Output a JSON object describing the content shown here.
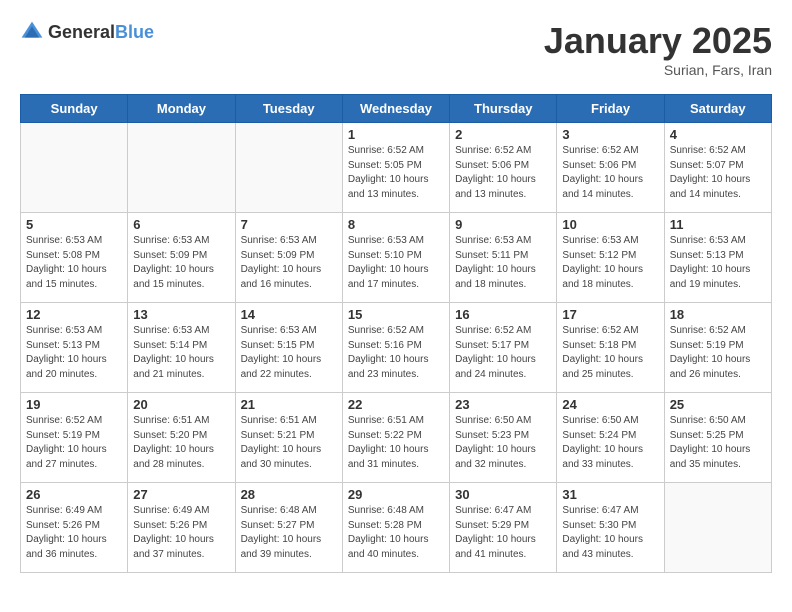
{
  "header": {
    "logo": {
      "general": "General",
      "blue": "Blue"
    },
    "title": "January 2025",
    "subtitle": "Surian, Fars, Iran"
  },
  "weekdays": [
    "Sunday",
    "Monday",
    "Tuesday",
    "Wednesday",
    "Thursday",
    "Friday",
    "Saturday"
  ],
  "weeks": [
    [
      {
        "day": "",
        "info": ""
      },
      {
        "day": "",
        "info": ""
      },
      {
        "day": "",
        "info": ""
      },
      {
        "day": "1",
        "info": "Sunrise: 6:52 AM\nSunset: 5:05 PM\nDaylight: 10 hours\nand 13 minutes."
      },
      {
        "day": "2",
        "info": "Sunrise: 6:52 AM\nSunset: 5:06 PM\nDaylight: 10 hours\nand 13 minutes."
      },
      {
        "day": "3",
        "info": "Sunrise: 6:52 AM\nSunset: 5:06 PM\nDaylight: 10 hours\nand 14 minutes."
      },
      {
        "day": "4",
        "info": "Sunrise: 6:52 AM\nSunset: 5:07 PM\nDaylight: 10 hours\nand 14 minutes."
      }
    ],
    [
      {
        "day": "5",
        "info": "Sunrise: 6:53 AM\nSunset: 5:08 PM\nDaylight: 10 hours\nand 15 minutes."
      },
      {
        "day": "6",
        "info": "Sunrise: 6:53 AM\nSunset: 5:09 PM\nDaylight: 10 hours\nand 15 minutes."
      },
      {
        "day": "7",
        "info": "Sunrise: 6:53 AM\nSunset: 5:09 PM\nDaylight: 10 hours\nand 16 minutes."
      },
      {
        "day": "8",
        "info": "Sunrise: 6:53 AM\nSunset: 5:10 PM\nDaylight: 10 hours\nand 17 minutes."
      },
      {
        "day": "9",
        "info": "Sunrise: 6:53 AM\nSunset: 5:11 PM\nDaylight: 10 hours\nand 18 minutes."
      },
      {
        "day": "10",
        "info": "Sunrise: 6:53 AM\nSunset: 5:12 PM\nDaylight: 10 hours\nand 18 minutes."
      },
      {
        "day": "11",
        "info": "Sunrise: 6:53 AM\nSunset: 5:13 PM\nDaylight: 10 hours\nand 19 minutes."
      }
    ],
    [
      {
        "day": "12",
        "info": "Sunrise: 6:53 AM\nSunset: 5:13 PM\nDaylight: 10 hours\nand 20 minutes."
      },
      {
        "day": "13",
        "info": "Sunrise: 6:53 AM\nSunset: 5:14 PM\nDaylight: 10 hours\nand 21 minutes."
      },
      {
        "day": "14",
        "info": "Sunrise: 6:53 AM\nSunset: 5:15 PM\nDaylight: 10 hours\nand 22 minutes."
      },
      {
        "day": "15",
        "info": "Sunrise: 6:52 AM\nSunset: 5:16 PM\nDaylight: 10 hours\nand 23 minutes."
      },
      {
        "day": "16",
        "info": "Sunrise: 6:52 AM\nSunset: 5:17 PM\nDaylight: 10 hours\nand 24 minutes."
      },
      {
        "day": "17",
        "info": "Sunrise: 6:52 AM\nSunset: 5:18 PM\nDaylight: 10 hours\nand 25 minutes."
      },
      {
        "day": "18",
        "info": "Sunrise: 6:52 AM\nSunset: 5:19 PM\nDaylight: 10 hours\nand 26 minutes."
      }
    ],
    [
      {
        "day": "19",
        "info": "Sunrise: 6:52 AM\nSunset: 5:19 PM\nDaylight: 10 hours\nand 27 minutes."
      },
      {
        "day": "20",
        "info": "Sunrise: 6:51 AM\nSunset: 5:20 PM\nDaylight: 10 hours\nand 28 minutes."
      },
      {
        "day": "21",
        "info": "Sunrise: 6:51 AM\nSunset: 5:21 PM\nDaylight: 10 hours\nand 30 minutes."
      },
      {
        "day": "22",
        "info": "Sunrise: 6:51 AM\nSunset: 5:22 PM\nDaylight: 10 hours\nand 31 minutes."
      },
      {
        "day": "23",
        "info": "Sunrise: 6:50 AM\nSunset: 5:23 PM\nDaylight: 10 hours\nand 32 minutes."
      },
      {
        "day": "24",
        "info": "Sunrise: 6:50 AM\nSunset: 5:24 PM\nDaylight: 10 hours\nand 33 minutes."
      },
      {
        "day": "25",
        "info": "Sunrise: 6:50 AM\nSunset: 5:25 PM\nDaylight: 10 hours\nand 35 minutes."
      }
    ],
    [
      {
        "day": "26",
        "info": "Sunrise: 6:49 AM\nSunset: 5:26 PM\nDaylight: 10 hours\nand 36 minutes."
      },
      {
        "day": "27",
        "info": "Sunrise: 6:49 AM\nSunset: 5:26 PM\nDaylight: 10 hours\nand 37 minutes."
      },
      {
        "day": "28",
        "info": "Sunrise: 6:48 AM\nSunset: 5:27 PM\nDaylight: 10 hours\nand 39 minutes."
      },
      {
        "day": "29",
        "info": "Sunrise: 6:48 AM\nSunset: 5:28 PM\nDaylight: 10 hours\nand 40 minutes."
      },
      {
        "day": "30",
        "info": "Sunrise: 6:47 AM\nSunset: 5:29 PM\nDaylight: 10 hours\nand 41 minutes."
      },
      {
        "day": "31",
        "info": "Sunrise: 6:47 AM\nSunset: 5:30 PM\nDaylight: 10 hours\nand 43 minutes."
      },
      {
        "day": "",
        "info": ""
      }
    ]
  ]
}
